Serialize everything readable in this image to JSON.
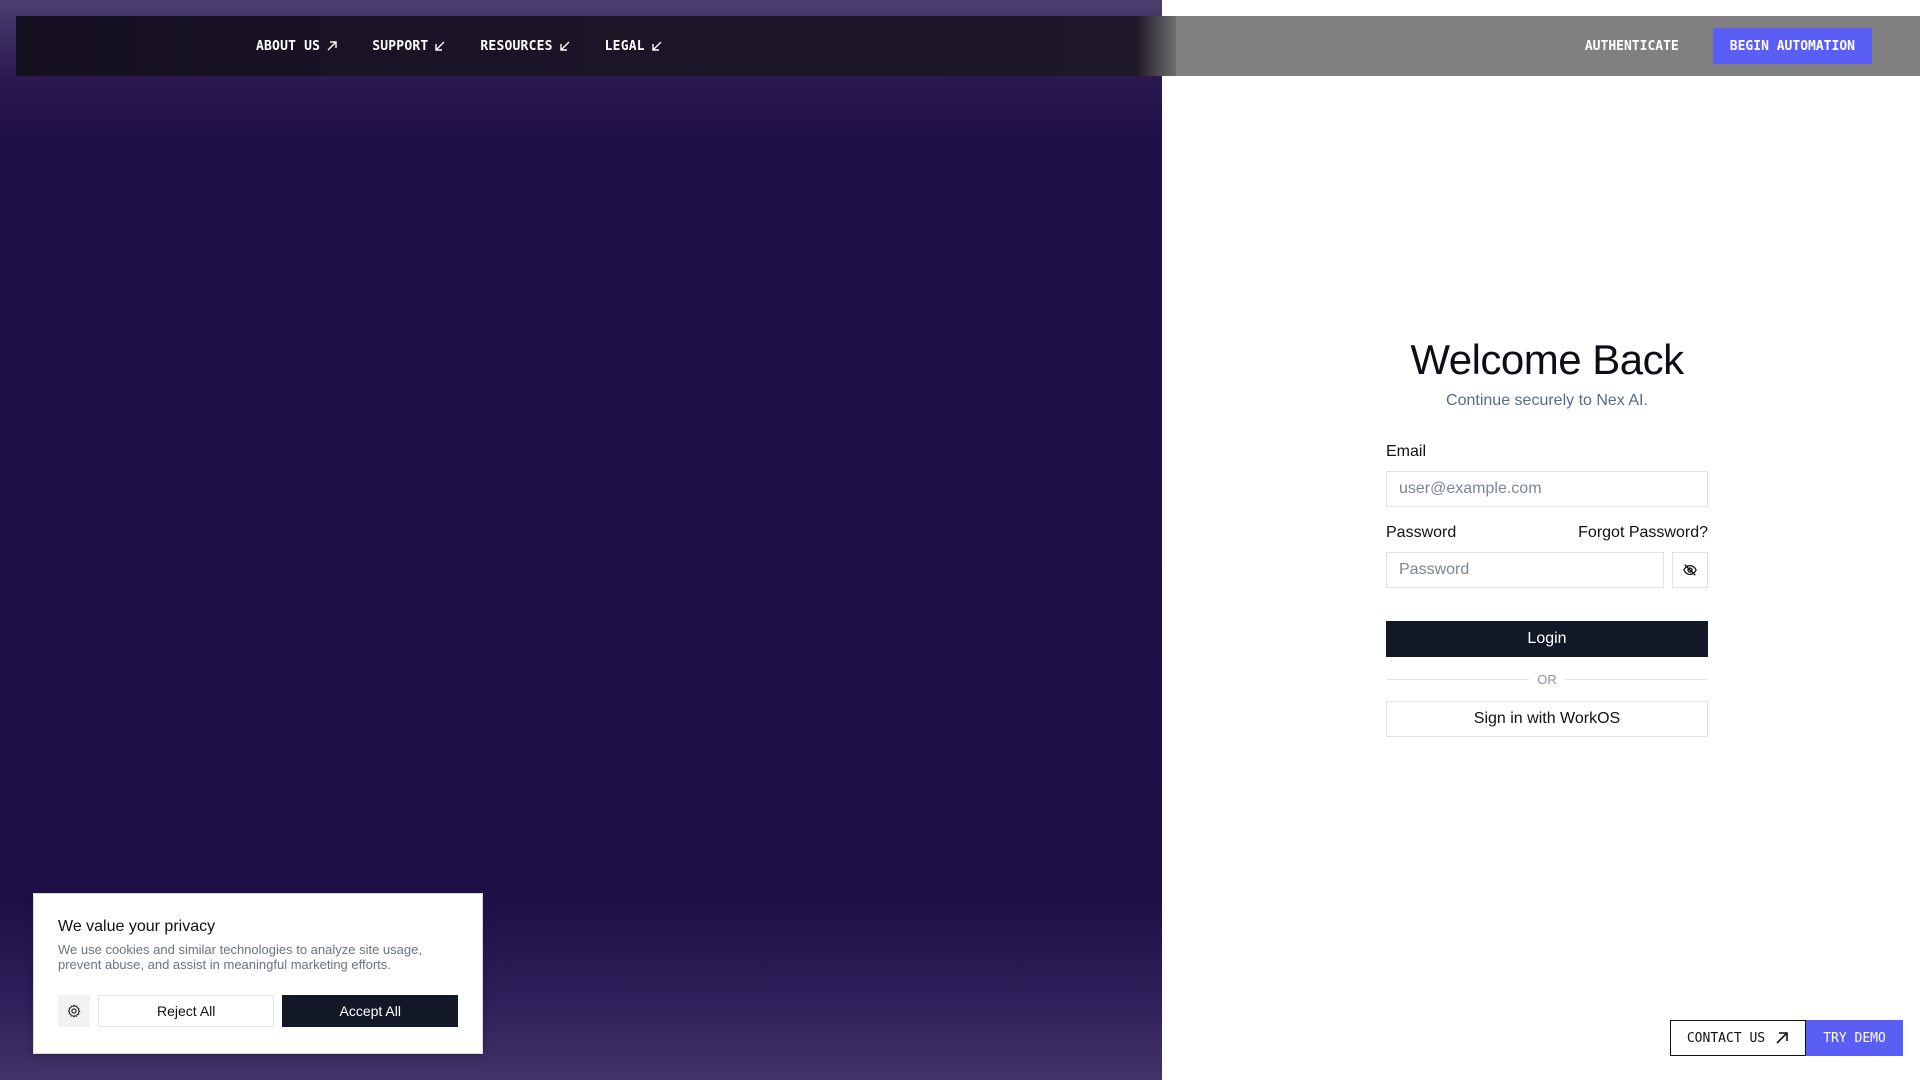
{
  "nav": {
    "links": [
      {
        "label": "ABOUT US",
        "icon": "arrow-up-right-icon"
      },
      {
        "label": "SUPPORT",
        "icon": "arrow-down-left-icon"
      },
      {
        "label": "RESOURCES",
        "icon": "arrow-down-left-icon"
      },
      {
        "label": "LEGAL",
        "icon": "arrow-down-left-icon"
      }
    ],
    "authenticate_label": "AUTHENTICATE",
    "begin_label": "BEGIN AUTOMATION"
  },
  "login": {
    "title": "Welcome Back",
    "subtitle": "Continue securely to Nex AI.",
    "email_label": "Email",
    "email_placeholder": "user@example.com",
    "password_label": "Password",
    "forgot_label": "Forgot Password?",
    "password_placeholder": "Password",
    "login_label": "Login",
    "or_label": "OR",
    "workos_label": "Sign in with WorkOS"
  },
  "cookie": {
    "title": "We value your privacy",
    "text": "We use cookies and similar technologies to analyze site usage, prevent abuse, and assist in meaningful marketing efforts.",
    "reject_label": "Reject All",
    "accept_label": "Accept All"
  },
  "bottom": {
    "contact_label": "CONTACT US",
    "demo_label": "TRY DEMO"
  },
  "colors": {
    "accent": "#5a5ef5",
    "dark": "#121826",
    "purple_bg": "#1f0f47"
  }
}
